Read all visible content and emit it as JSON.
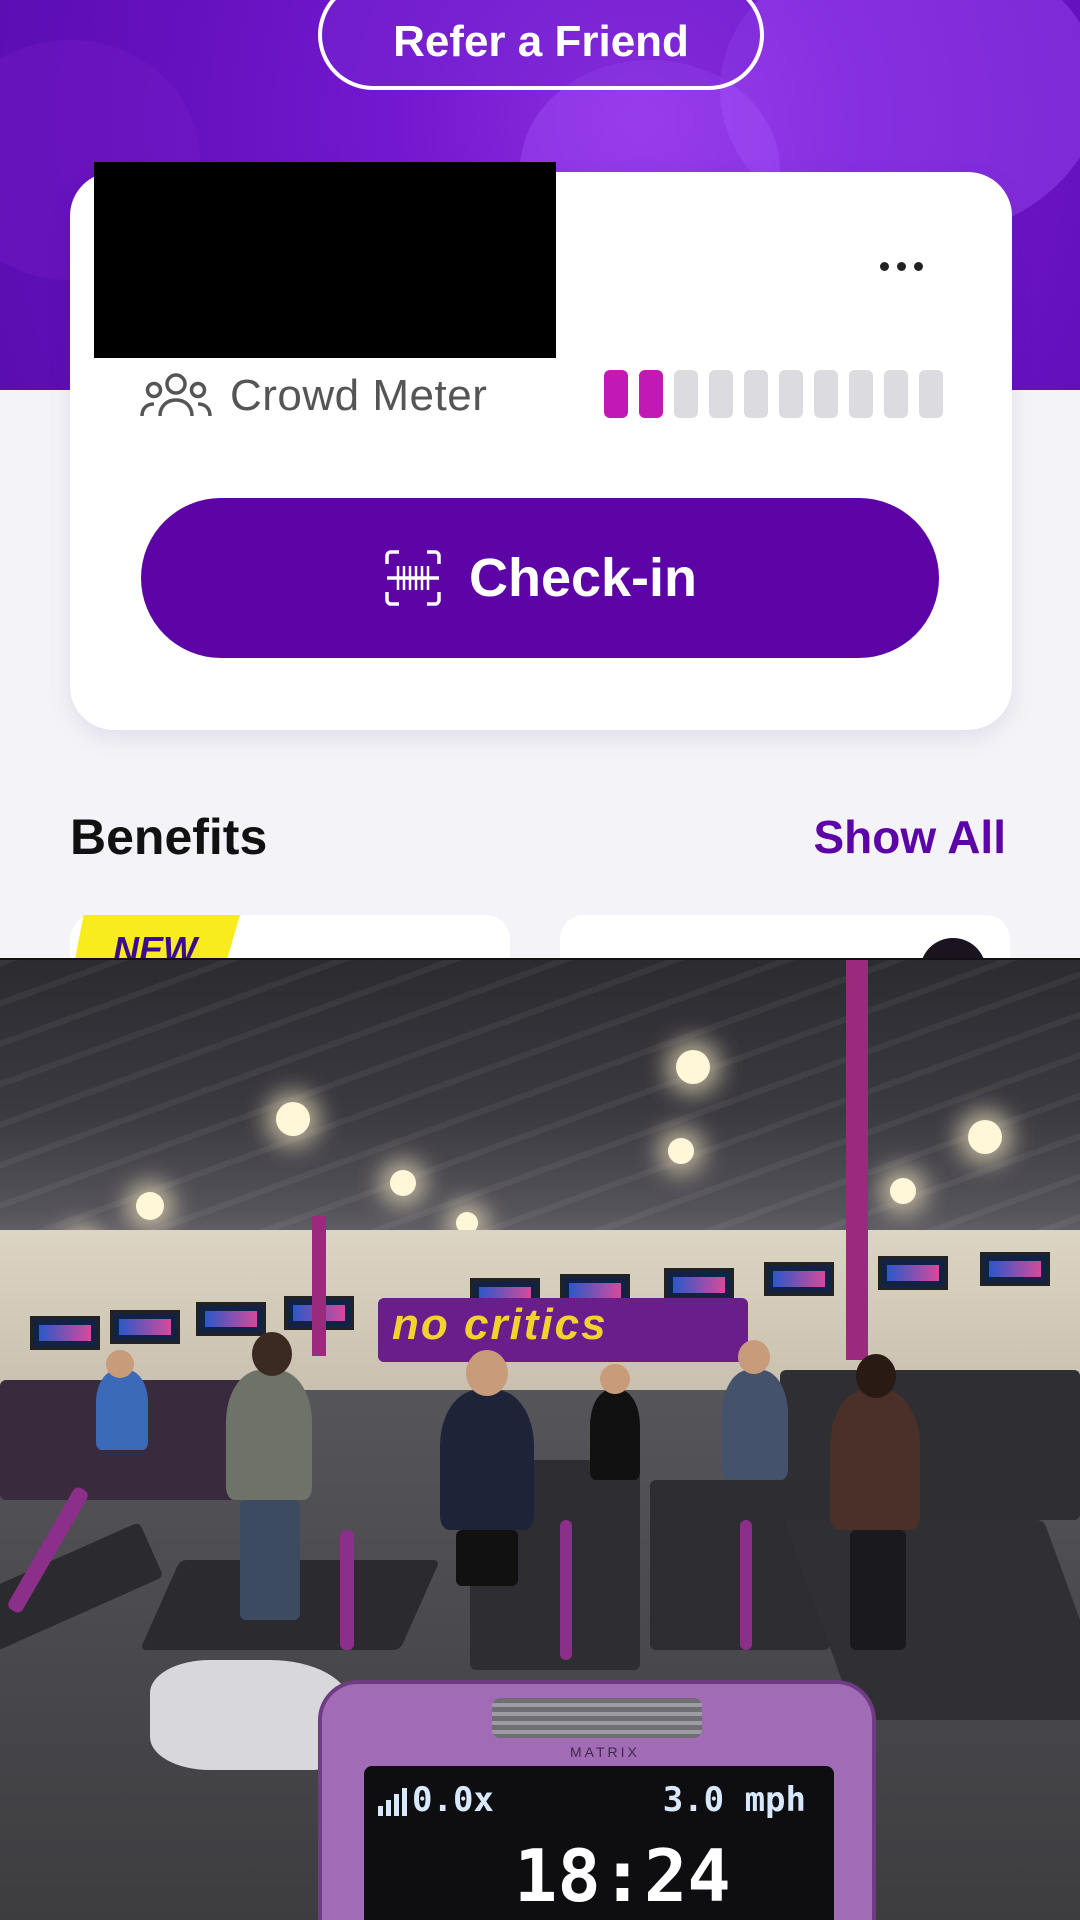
{
  "header": {
    "refer_label": "Refer a Friend"
  },
  "card": {
    "crowd_meter_label": "Crowd Meter",
    "crowd_meter": {
      "filled": 2,
      "total": 10,
      "fill_color": "#c218b4"
    },
    "checkin_label": "Check-in"
  },
  "benefits": {
    "title": "Benefits",
    "show_all_label": "Show All",
    "new_badge": "NEW"
  },
  "photo": {
    "sign_text": "no critics",
    "treadmill_brand": "MATRIX",
    "display": {
      "left_readout": "0.0x",
      "speed": "3.0 mph",
      "time": "18:24"
    }
  },
  "colors": {
    "brand_purple": "#5c04a6",
    "hero_purple": "#7318cf",
    "new_yellow": "#f8ec1e"
  }
}
